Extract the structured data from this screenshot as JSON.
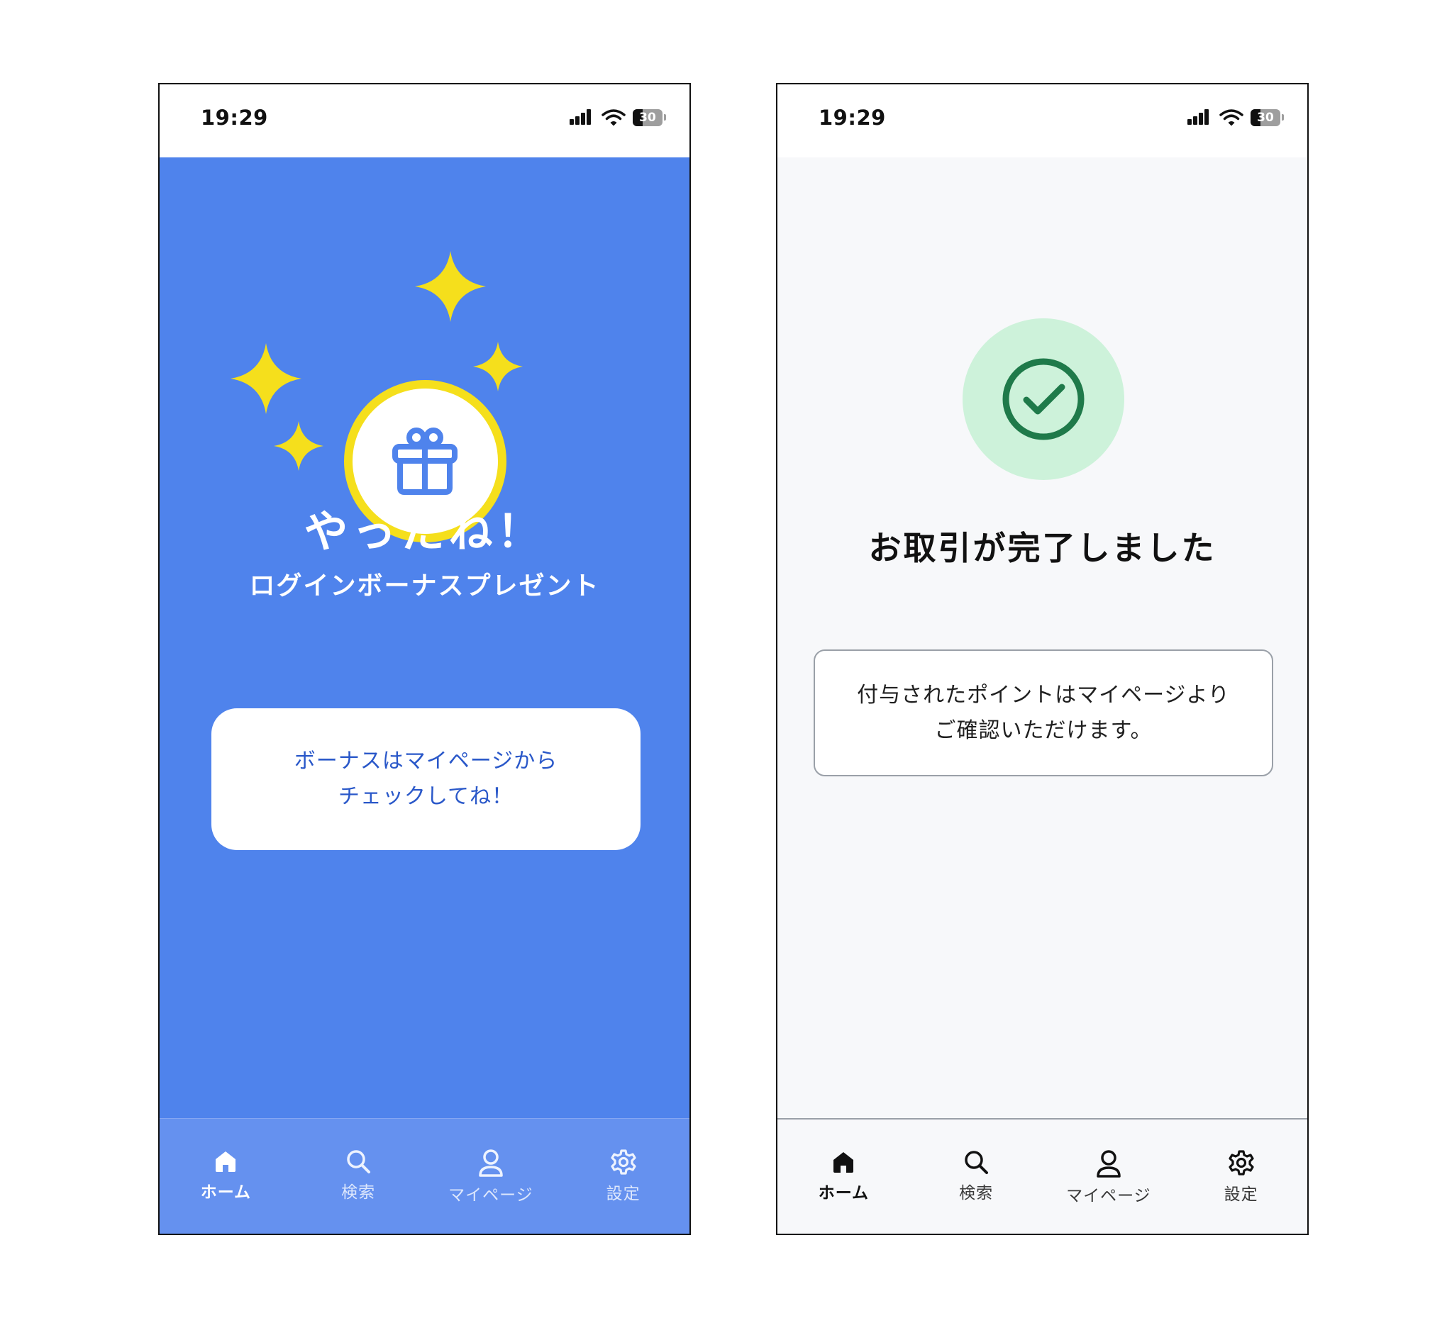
{
  "status_bar": {
    "time": "19:29",
    "battery": "30"
  },
  "bonus_screen": {
    "title": "やったね！",
    "subtitle": "ログインボーナスプレゼント",
    "message_lines": [
      "ボーナスはマイページから",
      "チェックしてね！"
    ],
    "icons": {
      "reward": "gift-icon",
      "decoration": "sparkle-icon"
    },
    "colors": {
      "background": "#4f83ec",
      "accent": "#f5df1c",
      "link_text": "#2a58c9"
    }
  },
  "complete_screen": {
    "title": "お取引が完了しました",
    "message_lines": [
      "付与されたポイントはマイページより",
      "ご確認いただけます。"
    ],
    "icon": "check-circle-icon",
    "colors": {
      "background": "#f7f8fa",
      "success_bg": "#cdf2da",
      "success_fg": "#1f7a4a"
    }
  },
  "tab_bar": {
    "active": "home",
    "tabs": [
      {
        "id": "home",
        "label": "ホーム",
        "icon": "home-icon"
      },
      {
        "id": "search",
        "label": "検索",
        "icon": "search-icon"
      },
      {
        "id": "mypage",
        "label": "マイページ",
        "icon": "user-icon"
      },
      {
        "id": "settings",
        "label": "設定",
        "icon": "gear-icon"
      }
    ]
  }
}
